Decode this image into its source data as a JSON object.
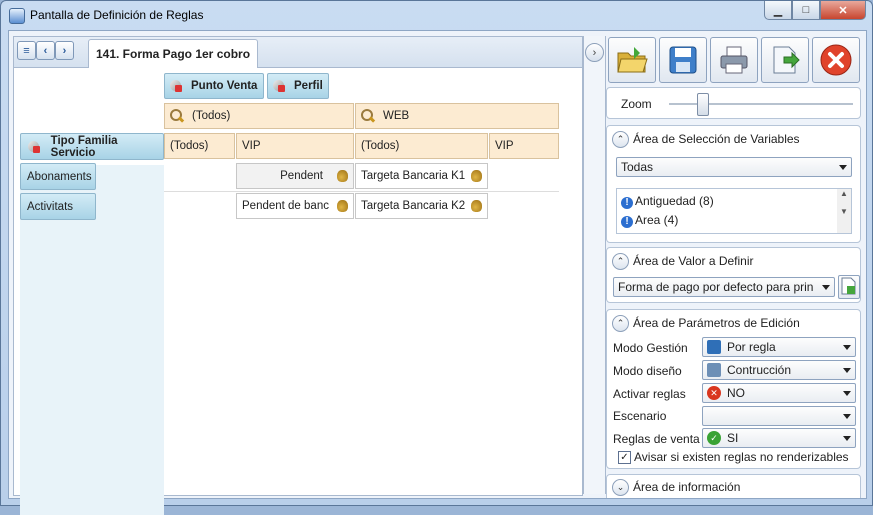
{
  "window": {
    "title": "Pantalla de Definición de Reglas",
    "min": "▁",
    "max": "□",
    "close": "✕"
  },
  "editor": {
    "tab_label": "141. Forma Pago 1er cobro",
    "col_headers": [
      "Punto Venta",
      "Perfil"
    ],
    "level1": [
      "(Todos)",
      "WEB"
    ],
    "level2": [
      "(Todos)",
      "VIP",
      "(Todos)",
      "VIP"
    ],
    "row_group_header": "Tipo Familia Servicio",
    "rows": [
      {
        "label": "Abonaments",
        "values": [
          "Pendent",
          "Targeta Bancaria K1"
        ]
      },
      {
        "label": "Activitats",
        "values": [
          "Pendent de banc",
          "Targeta Bancaria K2"
        ]
      }
    ]
  },
  "toolbar": {
    "icons": [
      "open-folder-icon",
      "save-icon",
      "printer-icon",
      "export-icon",
      "close-icon"
    ]
  },
  "zoom": {
    "label": "Zoom",
    "level": 0.18
  },
  "seleccion": {
    "title": "Área de Selección de Variables",
    "filter_value": "Todas",
    "variables": [
      "Antiguedad (8)",
      "Area (4)"
    ]
  },
  "valor": {
    "title": "Área de Valor a Definir",
    "value": "Forma de pago por defecto para prin"
  },
  "parametros": {
    "title": "Área de Parámetros de Edición",
    "fields": [
      {
        "label": "Modo Gestión",
        "value": "Por regla",
        "icon_color": "#2f6fb7"
      },
      {
        "label": "Modo diseño",
        "value": "Contrucción",
        "icon_color": "#6d8fb6"
      },
      {
        "label": "Activar reglas",
        "value": "NO",
        "icon_color": "#d9361f"
      },
      {
        "label": "Escenario",
        "value": "",
        "icon_color": ""
      },
      {
        "label": "Reglas de venta",
        "value": "SI",
        "icon_color": "#3aa335"
      }
    ],
    "checkbox_label": "Avisar si existen reglas no renderizables",
    "checkbox_checked": true
  },
  "informacion": {
    "title": "Área de información"
  }
}
